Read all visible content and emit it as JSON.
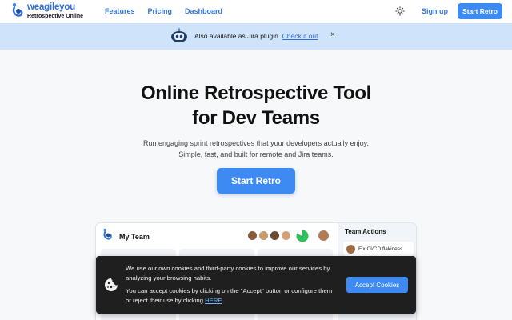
{
  "brand": {
    "name": "weagileyou",
    "tagline": "Retrospective Online",
    "color": "#3d8bf2"
  },
  "nav": {
    "links": [
      "Features",
      "Pricing",
      "Dashboard"
    ],
    "theme_icon": "sun-icon",
    "signup": "Sign up",
    "cta": "Start Retro"
  },
  "banner": {
    "text": "Also available as Jira plugin.",
    "link": "Check it out",
    "close": "×"
  },
  "hero": {
    "title_line1": "Online Retrospective Tool",
    "title_line2": "for Dev Teams",
    "sub_line1": "Run engaging sprint retrospectives that your developers actually enjoy.",
    "sub_line2": "Simple, fast, and built for remote and Jira teams.",
    "cta": "Start Retro"
  },
  "preview": {
    "team": "My Team",
    "side_title": "Team Actions",
    "action": "Fix CI/CD flakiness"
  },
  "cookie": {
    "line1": "We use our own cookies and third-party cookies to improve our services by analyzing your browsing habits.",
    "line2_pre": "You can accept cookies by clicking on the \"Accept\" button or configure them or reject their use by clicking ",
    "here": "HERE",
    "line2_post": ".",
    "accept": "Accept Cookies"
  }
}
